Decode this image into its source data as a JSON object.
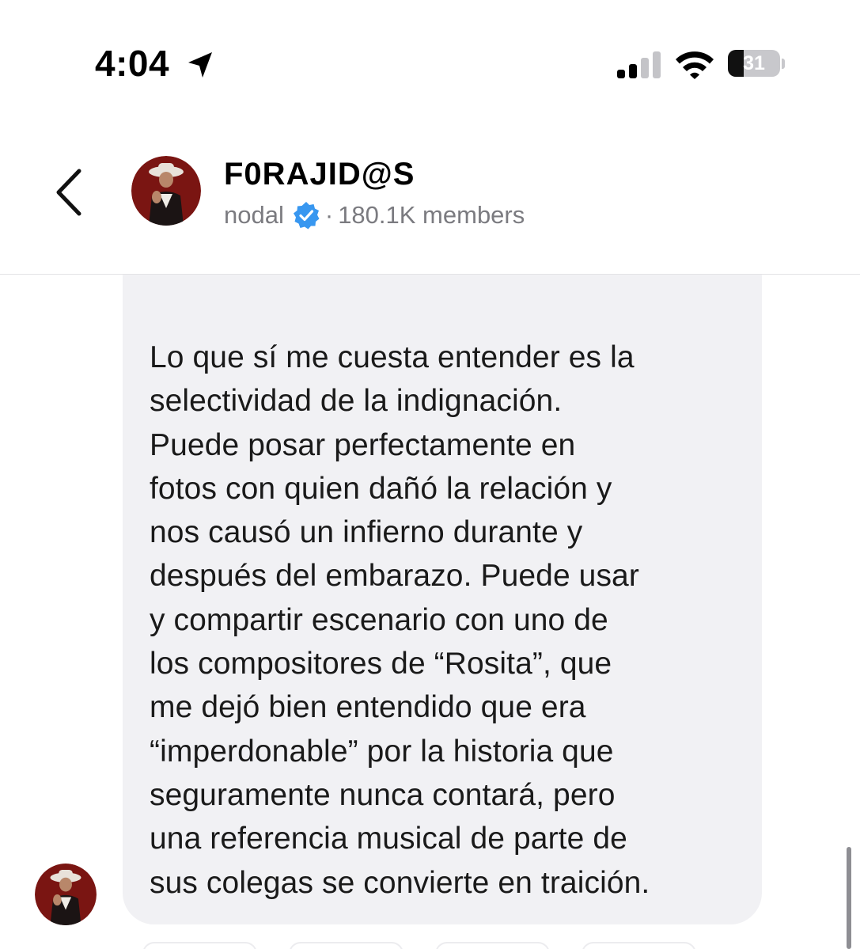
{
  "status_bar": {
    "time": "4:04",
    "battery_level": "31",
    "battery_fraction": 0.31,
    "icons": [
      "location-arrow-icon",
      "cellular-signal-icon",
      "wifi-icon",
      "battery-icon"
    ]
  },
  "header": {
    "channel_name": "F0RAJID@S",
    "owner": "nodal",
    "verified": true,
    "separator": "·",
    "members": "180.1K members",
    "icons": [
      "back-chevron-icon",
      "verified-badge-icon"
    ]
  },
  "message": {
    "text": "Lo que sí me cuesta entender es la\nselectividad de la indignación.\nPuede posar perfectamente en\nfotos con quien dañó la relación y\nnos causó un infierno durante y\ndespués del embarazo. Puede usar\ny compartir escenario con uno de\nlos compositores de “Rosita”, que\nme dejó bien entendido que era\n“imperdonable” por la historia que\nseguramente nunca contará, pero\nuna referencia musical de parte de\nsus colegas se convierte en traición."
  },
  "colors": {
    "bubble_background": "#f1f1f4",
    "secondary_text": "#7b7b80",
    "verified_blue": "#3897f0",
    "avatar_background": "#7a1512"
  }
}
